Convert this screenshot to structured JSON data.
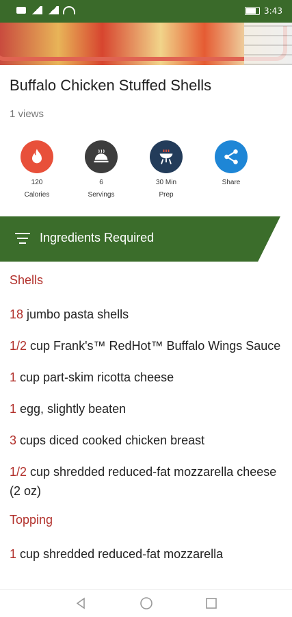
{
  "status_bar": {
    "time": "3:43",
    "left_indicators": [
      "sim-icon",
      "signal-icon",
      "signal-icon",
      "wifi-icon"
    ],
    "right_indicators": [
      "battery-icon"
    ]
  },
  "recipe": {
    "title": "Buffalo Chicken Stuffed Shells",
    "views": "1 views"
  },
  "stats": [
    {
      "value": "120",
      "label": "Calories",
      "icon": "flame-icon",
      "color": "#e8503a"
    },
    {
      "value": "6",
      "label": "Servings",
      "icon": "cloche-icon",
      "color": "#3d3d3d"
    },
    {
      "value": "30 Min",
      "label": "Prep",
      "icon": "grill-icon",
      "color": "#233c5a"
    },
    {
      "value": "",
      "label": "Share",
      "icon": "share-icon",
      "color": "#1e86d6"
    }
  ],
  "section": {
    "title": "Ingredients Required",
    "bar_color": "#3b6d2b",
    "heading_color": "#b2312c"
  },
  "groups": [
    {
      "heading": "Shells",
      "items": [
        {
          "qty": "18",
          "text": " jumbo pasta shells"
        },
        {
          "qty": "1/2",
          "text": " cup Frank's™ RedHot™ Buffalo Wings Sauce"
        },
        {
          "qty": "1",
          "text": " cup part-skim ricotta cheese"
        },
        {
          "qty": "1",
          "text": " egg, slightly beaten"
        },
        {
          "qty": "3",
          "text": " cups diced cooked chicken breast"
        },
        {
          "qty": "1/2",
          "text": " cup shredded reduced-fat mozzarella cheese (2 oz)"
        }
      ]
    },
    {
      "heading": "Topping",
      "items": [
        {
          "qty": "1",
          "text": " cup shredded reduced-fat mozzarella"
        }
      ]
    }
  ],
  "nav": [
    "back-icon",
    "home-icon",
    "recents-icon"
  ]
}
